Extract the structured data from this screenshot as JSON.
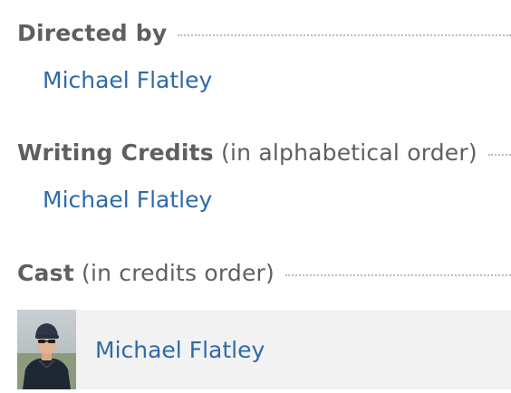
{
  "sections": {
    "directed_by": {
      "title": "Directed by",
      "people": [
        "Michael Flatley"
      ]
    },
    "writing_credits": {
      "title": "Writing Credits",
      "qualifier": "(in alphabetical order)",
      "people": [
        "Michael Flatley"
      ]
    },
    "cast": {
      "title": "Cast",
      "qualifier": "(in credits order)",
      "members": [
        {
          "name": "Michael Flatley",
          "photo_alt": "Michael Flatley"
        }
      ]
    }
  },
  "colors": {
    "link": "#2f6aa8",
    "header_text": "#5f5f5f",
    "row_background": "#f2f2f2",
    "dotted_rule": "#bdbdbd"
  }
}
